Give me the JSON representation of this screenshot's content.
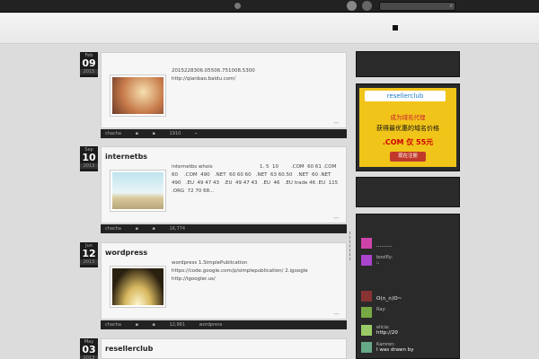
{
  "search": {
    "placeholder": ""
  },
  "posts": [
    {
      "month": "Feb",
      "day": "09",
      "year": "2015",
      "title": "",
      "text": "2015228306.05506.751008.5300\nhttp://qianbao.baidu.com/",
      "author": "chacha",
      "views": "1910",
      "tag": ""
    },
    {
      "month": "Sep",
      "day": "10",
      "year": "2013",
      "title": "internetbs",
      "text": "internetbs whois                              1. 5  10        .COM  60 61 .COM  60    .COM  490   .NET  60 60 60   .NET  63 60.50   .NET  60 .NET  490   .EU  49 47 43   .EU  49 47 43   .EU  46   .EU trade 46 .EU  115   .ORG  72 70 68...",
      "author": "chacha",
      "views": "16,774",
      "tag": ""
    },
    {
      "month": "Jun",
      "day": "12",
      "year": "2013",
      "title": "wordpress",
      "text": "wordpress 1.SimplePublication\nhttps://code.google.com/p/simplepublication/ 2.igoogle\nhttp://igoogler.us/",
      "author": "chacha",
      "views": "12,961",
      "tag": "wordpress"
    },
    {
      "month": "May",
      "day": "03",
      "year": "2013",
      "title": "resellerclub",
      "text": "",
      "author": "",
      "views": "",
      "tag": ""
    }
  ],
  "ad": {
    "brand": "resellerclub",
    "line1": "成为域名代理",
    "line2": "获得最优惠的域名价格",
    "line3": ".COM 仅 55元",
    "button": "现在注册"
  },
  "comments": [
    {
      "who": "",
      "msg": ".........."
    },
    {
      "who": "boolfly:",
      "msg": ":."
    },
    {
      "who": "",
      "msg": "O(∩_∩)O~"
    },
    {
      "who": "Ray:",
      "msg": ""
    },
    {
      "who": "elicia:",
      "msg": "http://20"
    },
    {
      "who": "Kamren:",
      "msg": "I was drawn by"
    }
  ],
  "colors": {
    "topbar": "#222222",
    "date_box": "#1c1c1c",
    "ad_bg": "#f1c419"
  }
}
